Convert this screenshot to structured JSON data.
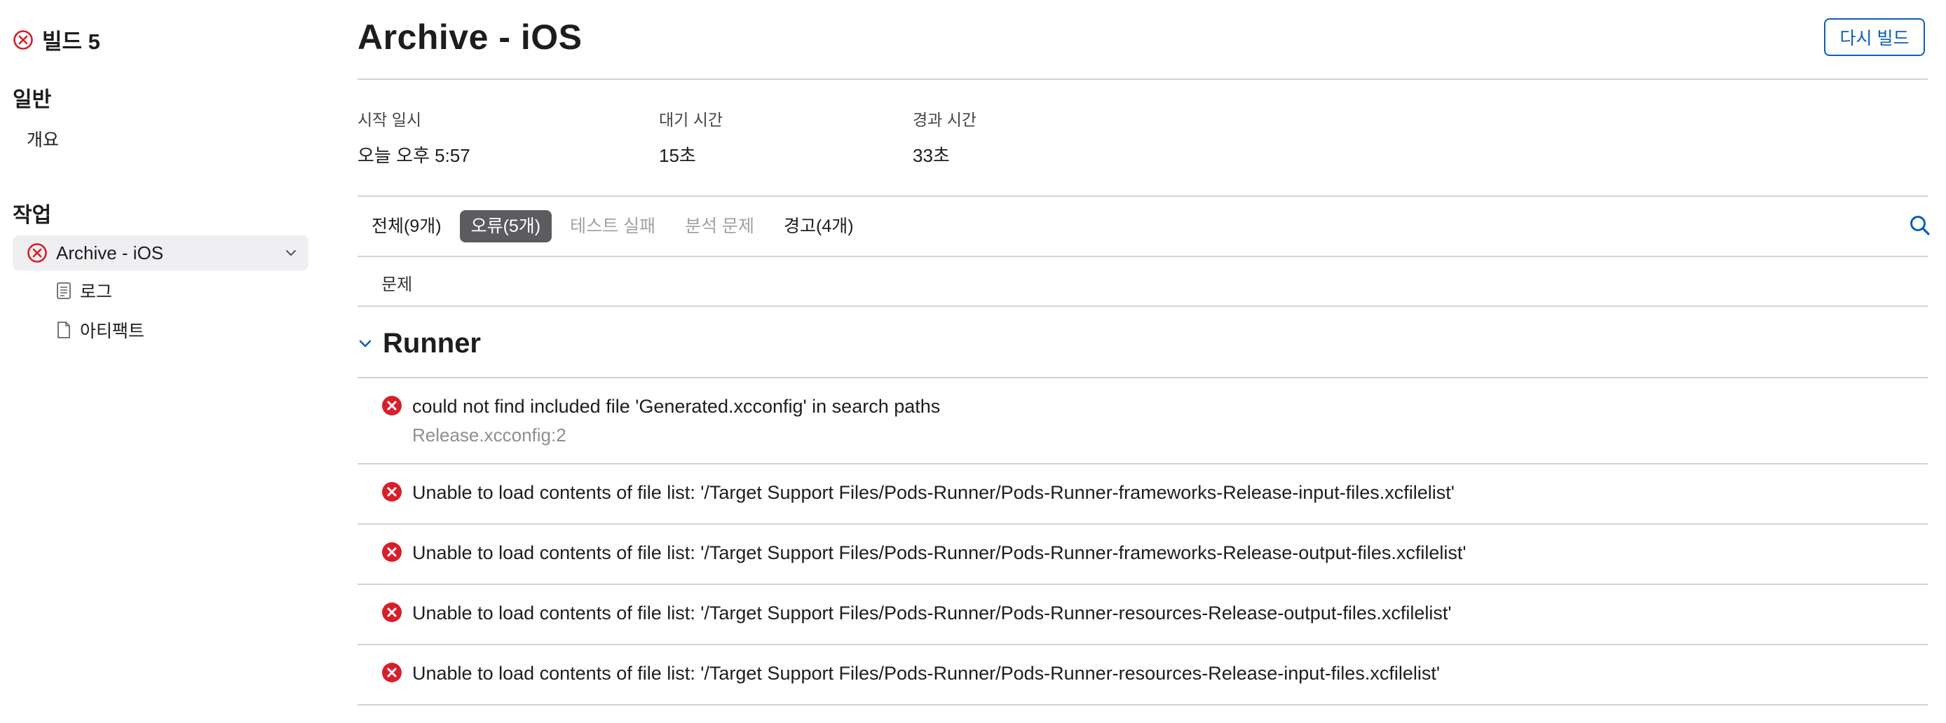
{
  "sidebar": {
    "build_title": "빌드 5",
    "general_heading": "일반",
    "overview_label": "개요",
    "tasks_heading": "작업",
    "task_label": "Archive - iOS",
    "log_label": "로그",
    "artifacts_label": "아티팩트"
  },
  "header": {
    "title": "Archive - iOS",
    "rebuild_label": "다시 빌드"
  },
  "meta": {
    "start_label": "시작 일시",
    "start_value": "오늘 오후 5:57",
    "wait_label": "대기 시간",
    "wait_value": "15초",
    "elapsed_label": "경과 시간",
    "elapsed_value": "33초"
  },
  "tabs": [
    {
      "label": "전체(9개)"
    },
    {
      "label": "오류(5개)"
    },
    {
      "label": "테스트 실패"
    },
    {
      "label": "분석 문제"
    },
    {
      "label": "경고(4개)"
    }
  ],
  "table": {
    "column_header": "문제",
    "group_title": "Runner"
  },
  "issues": [
    {
      "message": "could not find included file 'Generated.xcconfig' in search paths",
      "location": "Release.xcconfig:2"
    },
    {
      "message": "Unable to load contents of file list: '/Target Support Files/Pods-Runner/Pods-Runner-frameworks-Release-input-files.xcfilelist'"
    },
    {
      "message": "Unable to load contents of file list: '/Target Support Files/Pods-Runner/Pods-Runner-frameworks-Release-output-files.xcfilelist'"
    },
    {
      "message": "Unable to load contents of file list: '/Target Support Files/Pods-Runner/Pods-Runner-resources-Release-output-files.xcfilelist'"
    },
    {
      "message": "Unable to load contents of file list: '/Target Support Files/Pods-Runner/Pods-Runner-resources-Release-input-files.xcfilelist'"
    }
  ],
  "colors": {
    "error": "#d71f2b",
    "accent": "#0a5fb7",
    "active_tab": "#5c5c60"
  }
}
